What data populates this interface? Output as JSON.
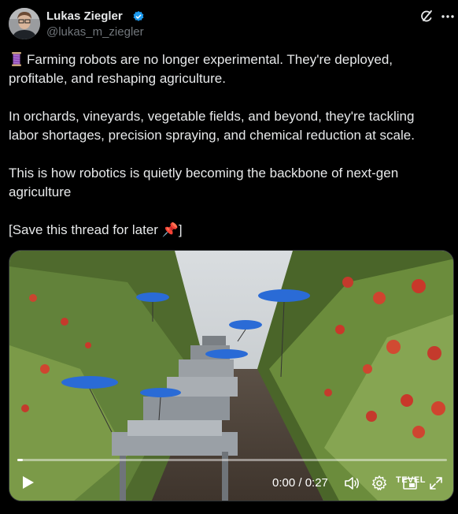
{
  "author": {
    "display_name": "Lukas Ziegler",
    "handle": "@lukas_m_ziegler",
    "verified": true,
    "verified_color": "#1d9bf0"
  },
  "tweet": {
    "paragraphs": [
      "Farming robots are no longer experimental. They're deployed, profitable, and reshaping agriculture.",
      "In orchards, vineyards, vegetable fields, and beyond, they're tackling labor shortages, precision spraying, and chemical reduction at scale.",
      "This is how robotics is quietly becoming the backbone of next-gen agriculture",
      "[Save this thread for later 📌]"
    ],
    "leading_emoji": "thread-icon"
  },
  "video": {
    "current_time": "0:00",
    "duration": "0:27",
    "time_display": "0:00 / 0:27",
    "progress": 0.0,
    "watermark": "TEVEL"
  },
  "icons": {
    "grok": "grok-icon",
    "play": "play-icon",
    "volume": "volume-icon",
    "settings": "gear-icon",
    "pip": "picture-in-picture-icon",
    "fullscreen": "fullscreen-icon"
  }
}
